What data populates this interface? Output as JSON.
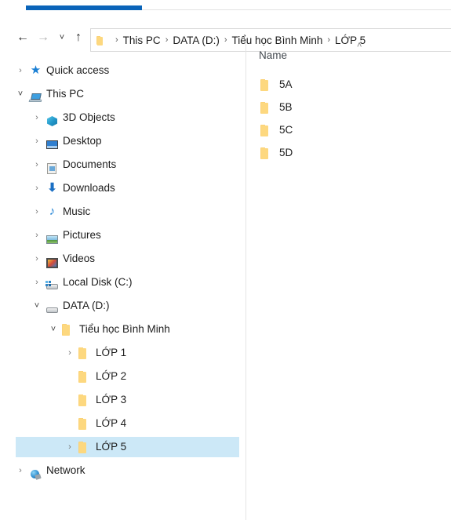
{
  "window": {
    "ribbon_active_tab": "home-tab-underline",
    "accent_color": "#0a64b9",
    "selection_color": "#cce8f7",
    "folder_color": "#fdd87f"
  },
  "navbar": {
    "back_label": "←",
    "forward_label": "→",
    "recent_label": "˅",
    "up_label": "↑",
    "breadcrumb": [
      "This PC",
      "DATA (D:)",
      "Tiểu học Bình Minh",
      "LỚP 5"
    ],
    "separator": "›"
  },
  "sidebar": {
    "items": [
      {
        "label": "Quick access",
        "icon": "star-icon",
        "indent": 0,
        "chevron": "collapsed",
        "selected": false
      },
      {
        "label": "This PC",
        "icon": "this-pc-icon",
        "indent": 0,
        "chevron": "expanded",
        "selected": false
      },
      {
        "label": "3D Objects",
        "icon": "3d-objects-icon",
        "indent": 1,
        "chevron": "collapsed",
        "selected": false
      },
      {
        "label": "Desktop",
        "icon": "desktop-icon",
        "indent": 1,
        "chevron": "collapsed",
        "selected": false
      },
      {
        "label": "Documents",
        "icon": "documents-icon",
        "indent": 1,
        "chevron": "collapsed",
        "selected": false
      },
      {
        "label": "Downloads",
        "icon": "downloads-icon",
        "indent": 1,
        "chevron": "collapsed",
        "selected": false
      },
      {
        "label": "Music",
        "icon": "music-icon",
        "indent": 1,
        "chevron": "collapsed",
        "selected": false
      },
      {
        "label": "Pictures",
        "icon": "pictures-icon",
        "indent": 1,
        "chevron": "collapsed",
        "selected": false
      },
      {
        "label": "Videos",
        "icon": "videos-icon",
        "indent": 1,
        "chevron": "collapsed",
        "selected": false
      },
      {
        "label": "Local Disk (C:)",
        "icon": "system-drive-icon",
        "indent": 1,
        "chevron": "collapsed",
        "selected": false
      },
      {
        "label": "DATA (D:)",
        "icon": "drive-icon",
        "indent": 1,
        "chevron": "expanded",
        "selected": false
      },
      {
        "label": "Tiểu học Bình Minh",
        "icon": "folder-icon",
        "indent": 2,
        "chevron": "expanded",
        "selected": false
      },
      {
        "label": "LỚP 1",
        "icon": "folder-icon",
        "indent": 3,
        "chevron": "collapsed",
        "selected": false
      },
      {
        "label": "LỚP 2",
        "icon": "folder-icon",
        "indent": 3,
        "chevron": "none",
        "selected": false
      },
      {
        "label": "LỚP 3",
        "icon": "folder-icon",
        "indent": 3,
        "chevron": "none",
        "selected": false
      },
      {
        "label": "LỚP 4",
        "icon": "folder-icon",
        "indent": 3,
        "chevron": "none",
        "selected": false
      },
      {
        "label": "LỚP 5",
        "icon": "folder-icon",
        "indent": 3,
        "chevron": "collapsed",
        "selected": true
      },
      {
        "label": "Network",
        "icon": "network-icon",
        "indent": 0,
        "chevron": "collapsed",
        "selected": false
      }
    ]
  },
  "filepane": {
    "column_header": "Name",
    "sort_caret": "˄",
    "items": [
      {
        "name": "5A",
        "icon": "folder-icon"
      },
      {
        "name": "5B",
        "icon": "folder-icon"
      },
      {
        "name": "5C",
        "icon": "folder-icon"
      },
      {
        "name": "5D",
        "icon": "folder-icon"
      }
    ]
  }
}
